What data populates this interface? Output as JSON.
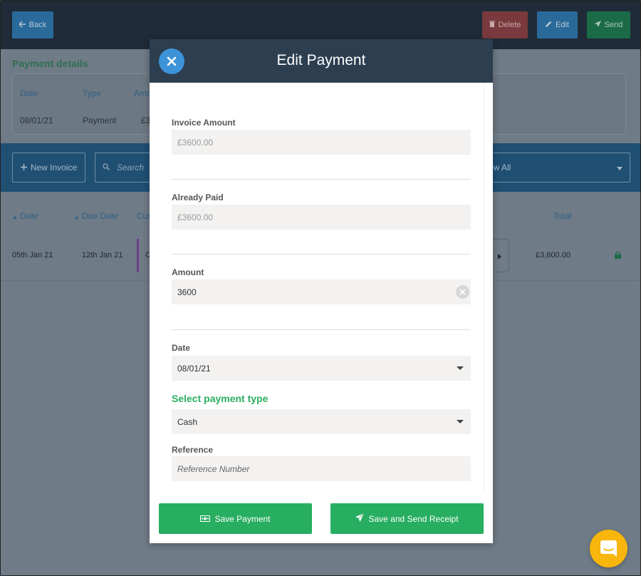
{
  "topbar": {
    "back_label": "Back",
    "delete_label": "Delete",
    "edit_label": "Edit",
    "send_label": "Send"
  },
  "payment_details": {
    "title": "Payment details",
    "headers": [
      "Date",
      "Type",
      "Amo"
    ],
    "values": [
      "08/01/21",
      "Payment",
      "£3"
    ]
  },
  "toolbar": {
    "new_invoice_label": "New Invoice",
    "search_placeholder": "Search",
    "filter_value": "ow All"
  },
  "table": {
    "headers": [
      "Date",
      "Due Date",
      "Cus",
      "Total"
    ],
    "rows": [
      {
        "date": "05th Jan 21",
        "due_date": "12th Jan 21",
        "customer": "C",
        "total": "£3,600.00"
      }
    ]
  },
  "modal": {
    "title": "Edit Payment",
    "invoice_amount": {
      "label": "Invoice Amount",
      "value": "£3600.00"
    },
    "already_paid": {
      "label": "Already Paid",
      "value": "£3600.00"
    },
    "amount": {
      "label": "Amount",
      "value": "3600"
    },
    "date": {
      "label": "Date",
      "value": "08/01/21"
    },
    "payment_type": {
      "title": "Select payment type",
      "value": "Cash"
    },
    "reference": {
      "label": "Reference",
      "placeholder": "Reference Number"
    },
    "save_label": "Save Payment",
    "save_send_label": "Save and Send Receipt"
  },
  "colors": {
    "accent_green": "#27ae60",
    "header_navy": "#2c3e50",
    "close_blue": "#3d93d8",
    "chat_yellow": "#f8b50c"
  }
}
